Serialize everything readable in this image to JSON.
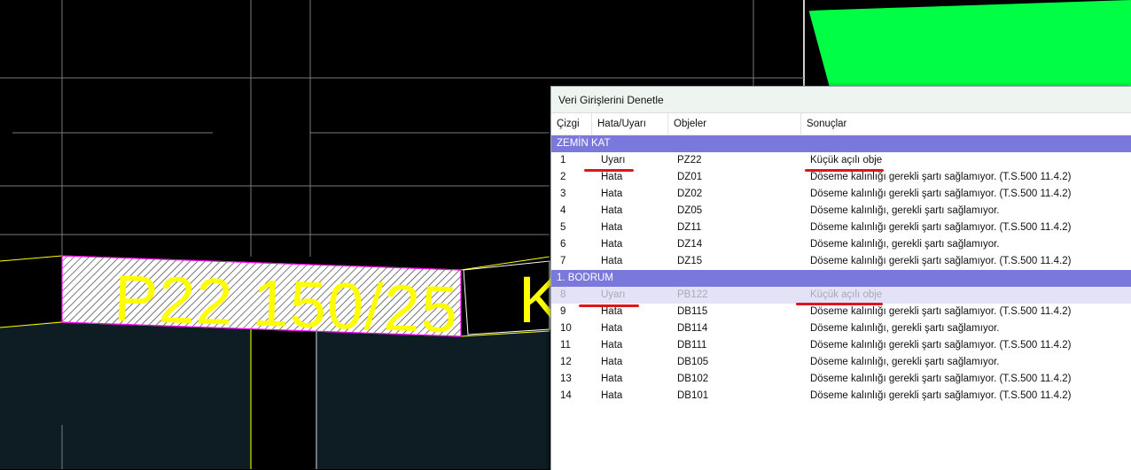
{
  "cad": {
    "label_1": "P22 150/25",
    "label_2": "K"
  },
  "dialog": {
    "title": "Veri Girişlerini Denetle",
    "columns": [
      "Çizgi",
      "Hata/Uyarı",
      "Objeler",
      "Sonuçlar"
    ],
    "groups": [
      {
        "name": "ZEMİN KAT",
        "rows": [
          {
            "line": "1",
            "type": "Uyarı",
            "object": "PZ22",
            "result": "Küçük açılı obje"
          },
          {
            "line": "2",
            "type": "Hata",
            "object": "DZ01",
            "result": "Döseme kalınlığı gerekli şartı sağlamıyor. (T.S.500 11.4.2)"
          },
          {
            "line": "3",
            "type": "Hata",
            "object": "DZ02",
            "result": "Döseme kalınlığı gerekli şartı sağlamıyor. (T.S.500 11.4.2)"
          },
          {
            "line": "4",
            "type": "Hata",
            "object": "DZ05",
            "result": "Döseme kalınlığı, gerekli şartı sağlamıyor."
          },
          {
            "line": "5",
            "type": "Hata",
            "object": "DZ11",
            "result": "Döseme kalınlığı gerekli şartı sağlamıyor. (T.S.500 11.4.2)"
          },
          {
            "line": "6",
            "type": "Hata",
            "object": "DZ14",
            "result": "Döseme kalınlığı, gerekli şartı sağlamıyor."
          },
          {
            "line": "7",
            "type": "Hata",
            "object": "DZ15",
            "result": "Döseme kalınlığı gerekli şartı sağlamıyor. (T.S.500 11.4.2)"
          }
        ]
      },
      {
        "name": "1. BODRUM",
        "rows": [
          {
            "line": "8",
            "type": "Uyarı",
            "object": "PB122",
            "result": "Küçük açılı obje"
          },
          {
            "line": "9",
            "type": "Hata",
            "object": "DB115",
            "result": "Döseme kalınlığı gerekli şartı sağlamıyor. (T.S.500 11.4.2)"
          },
          {
            "line": "10",
            "type": "Hata",
            "object": "DB114",
            "result": "Döseme kalınlığı, gerekli şartı sağlamıyor."
          },
          {
            "line": "11",
            "type": "Hata",
            "object": "DB111",
            "result": "Döseme kalınlığı gerekli şartı sağlamıyor. (T.S.500 11.4.2)"
          },
          {
            "line": "12",
            "type": "Hata",
            "object": "DB105",
            "result": "Döseme kalınlığı, gerekli şartı sağlamıyor."
          },
          {
            "line": "13",
            "type": "Hata",
            "object": "DB102",
            "result": "Döseme kalınlığı gerekli şartı sağlamıyor. (T.S.500 11.4.2)"
          },
          {
            "line": "14",
            "type": "Hata",
            "object": "DB101",
            "result": "Döseme kalınlığı gerekli şartı sağlamıyor. (T.S.500 11.4.2)"
          }
        ]
      }
    ],
    "selected_line": "8"
  },
  "colors": {
    "group_header": "#7b78dc",
    "selected_row": "#e3e2f6",
    "annotation_red": "#e0151b",
    "cad_yellow": "#ffff00",
    "cad_green": "#00ff44"
  }
}
